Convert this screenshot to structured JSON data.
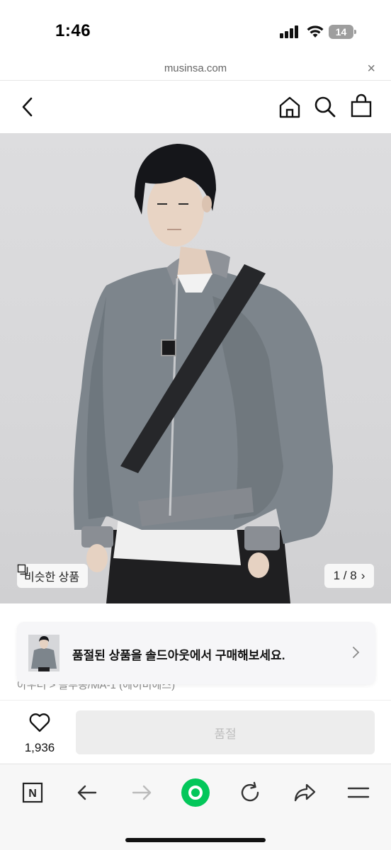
{
  "status_bar": {
    "time": "1:46",
    "battery": "14"
  },
  "browser": {
    "url": "musinsa.com",
    "close_label": "×"
  },
  "header": {
    "back_icon": "chevron-left-icon",
    "home_icon": "home-icon",
    "search_icon": "search-icon",
    "cart_icon": "shopping-bag-icon"
  },
  "gallery": {
    "similar_label": "비슷한 상품",
    "counter": "1 / 8",
    "counter_chevron": "›"
  },
  "breadcrumb": "아우터 > 블루종/MA-1 (에이비에스)",
  "toast": {
    "message": "품절된 상품을 솔드아웃에서 구매해보세요.",
    "chevron": "›"
  },
  "buy_bar": {
    "like_count": "1,936",
    "soldout_label": "품절"
  },
  "toolbar": {
    "items": [
      "naver-icon",
      "back-arrow-icon",
      "forward-arrow-icon",
      "green-dot-icon",
      "refresh-icon",
      "share-icon",
      "menu-icon"
    ],
    "naver_label": "N"
  },
  "colors": {
    "accent_green": "#03c75a",
    "soldout_bg": "#ededed",
    "soldout_text": "#bdbdbd"
  }
}
